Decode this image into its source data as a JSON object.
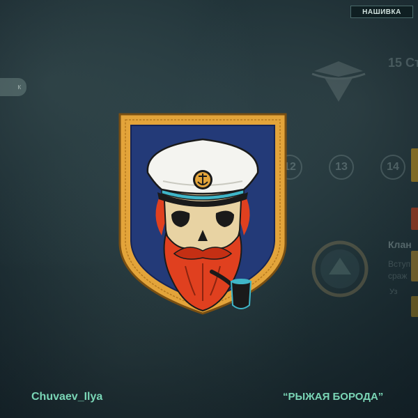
{
  "header": {
    "tag_label": "НАШИВКА"
  },
  "background": {
    "side_button_label": "к",
    "rank_title": "15 Ст",
    "levels": [
      "12",
      "13",
      "14"
    ],
    "side_title": "Клан",
    "side_lines": [
      "Вступ",
      "сраж"
    ],
    "side_link": "Уз"
  },
  "footer": {
    "author": "Chuvaev_Ilya",
    "patch_name": "“РЫЖАЯ БОРОДА”"
  },
  "colors": {
    "accent_text": "#7ad6b6",
    "patch_border": "#e3a43a",
    "patch_field": "#233a78",
    "beard": "#e0401f"
  },
  "icons": [
    "captain-skull-emblem",
    "anchor-icon",
    "pipe-icon"
  ]
}
